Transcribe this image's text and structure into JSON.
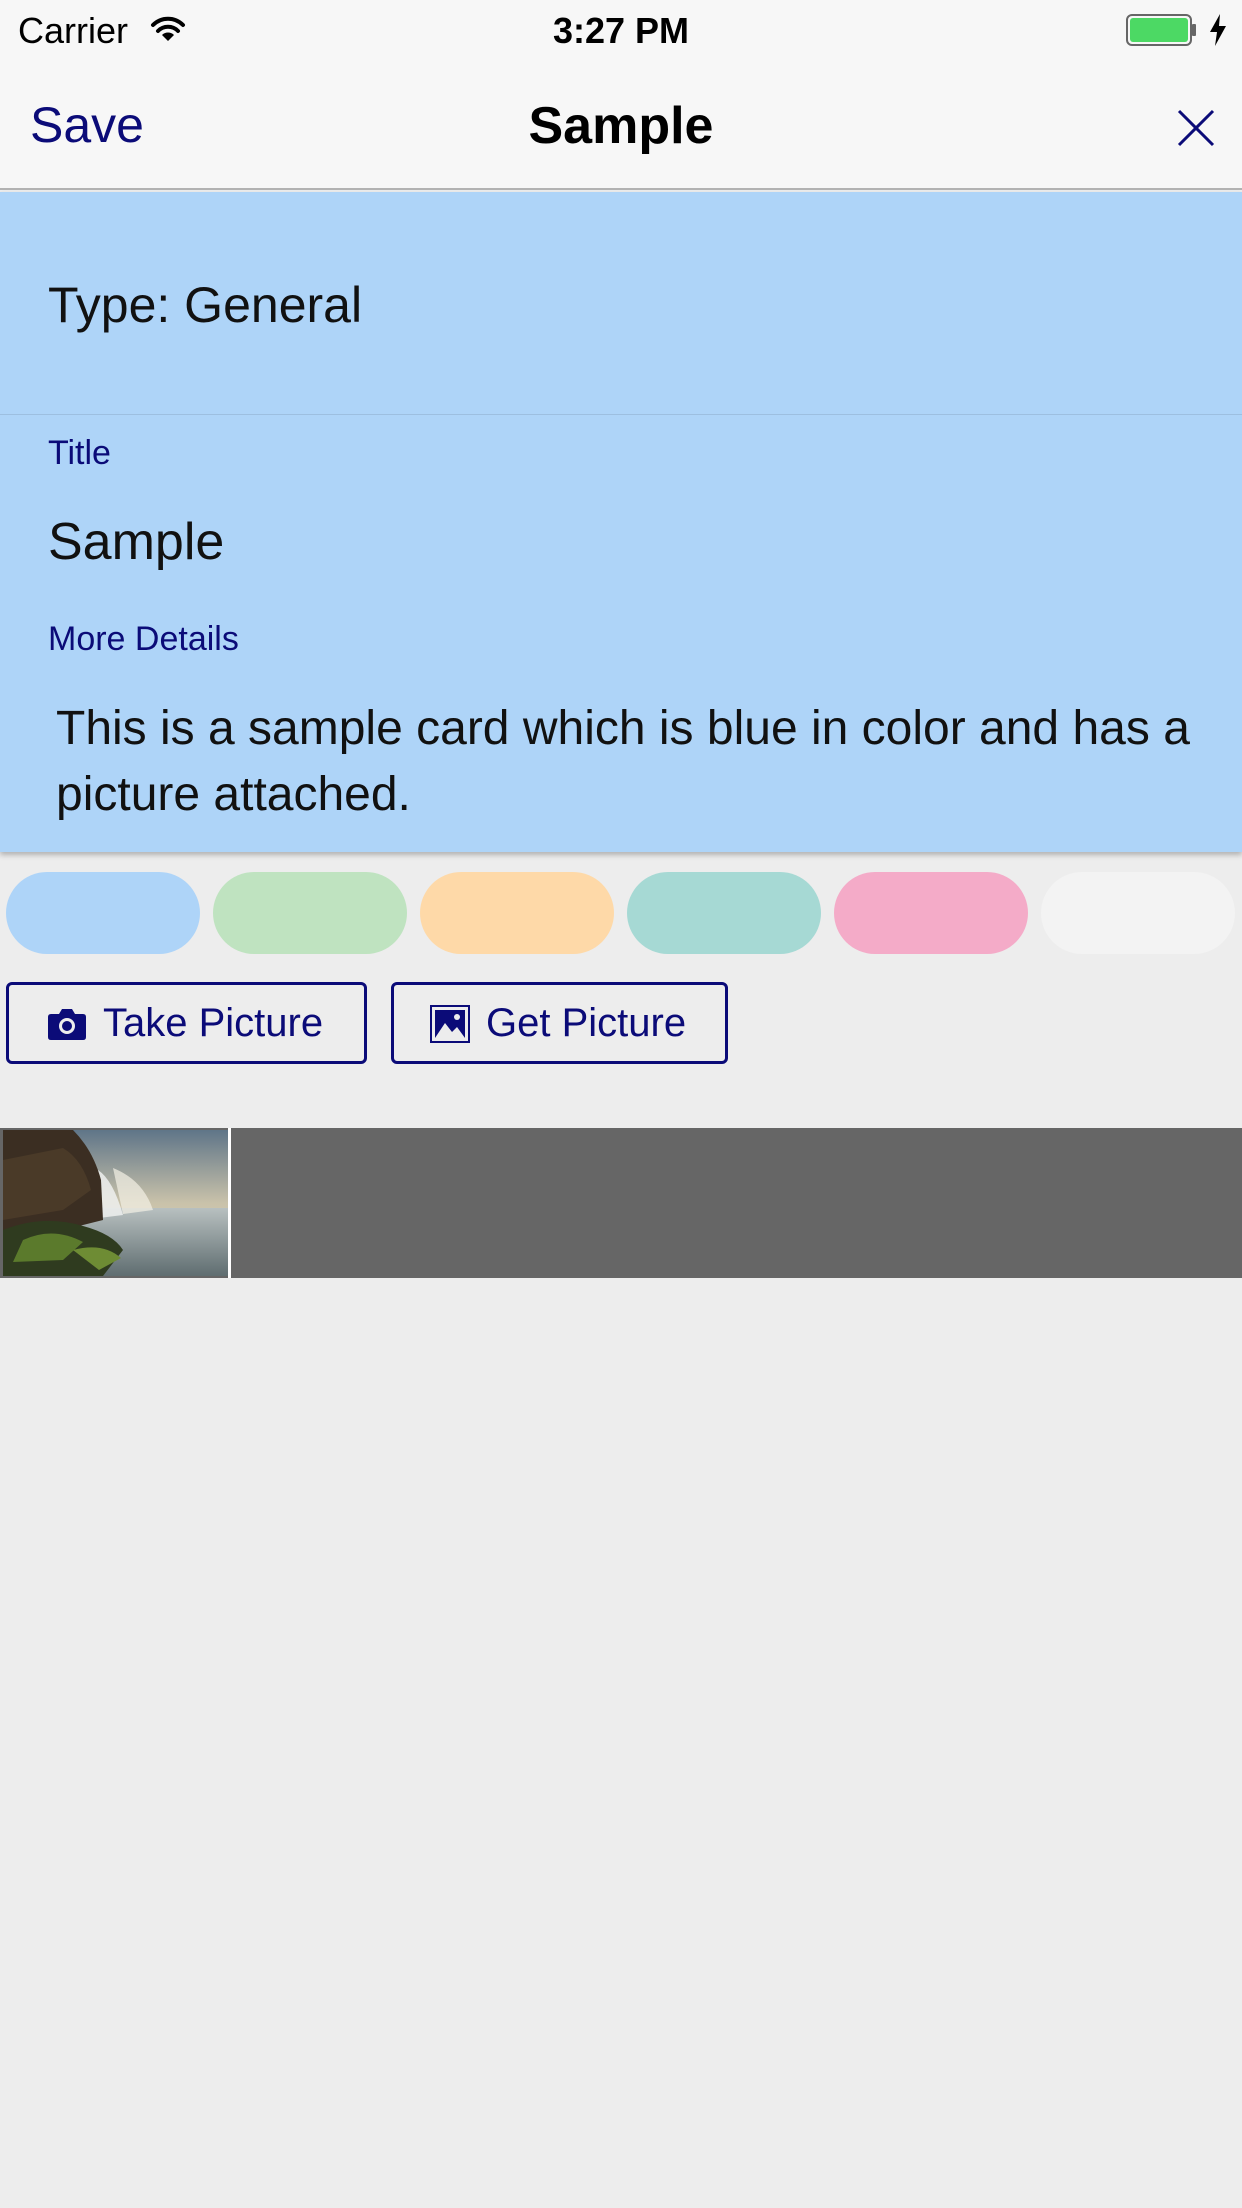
{
  "status_bar": {
    "carrier": "Carrier",
    "time": "3:27 PM",
    "battery_color": "#4cd964"
  },
  "nav": {
    "save_label": "Save",
    "title": "Sample",
    "close_icon": "close-icon"
  },
  "card": {
    "background": "#aed4f8",
    "type_text": "Type: General",
    "title_label": "Title",
    "title_value": "Sample",
    "details_label": "More Details",
    "details_value": "This is a sample card which is blue in color and has a picture attached."
  },
  "color_swatches": [
    {
      "color": "#aed4f8",
      "selected": true
    },
    {
      "color": "#bfe3c0"
    },
    {
      "color": "#fed9a8"
    },
    {
      "color": "#a6d9d4"
    },
    {
      "color": "#f4abc8"
    },
    {
      "color": "#f3f3f3"
    }
  ],
  "actions": {
    "take_picture": "Take Picture",
    "get_picture": "Get Picture",
    "take_icon": "camera-icon",
    "get_icon": "image-icon"
  },
  "gallery": {
    "background": "#666666",
    "images": [
      {
        "subject": "waterfall landscape photo"
      }
    ]
  }
}
